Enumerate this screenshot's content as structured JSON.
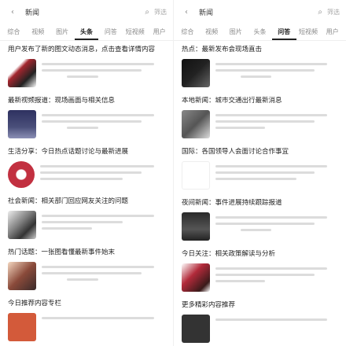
{
  "left": {
    "search_text": "新闻",
    "filter_label": "筛选",
    "tabs": [
      "综合",
      "视频",
      "图片",
      "头条",
      "问答",
      "短视频",
      "用户"
    ],
    "active_tab": 3,
    "items": [
      {
        "title": "用户发布了新的图文动态消息，点击查看详情内容",
        "thumb_color": "#a3262e"
      },
      {
        "title": "最新视频报道：现场画面与相关信息",
        "thumb_color": "#4a4f7a"
      },
      {
        "title": "生活分享：今日热点话题讨论与最新进展",
        "thumb_color": "#c23040"
      },
      {
        "title": "社会新闻：相关部门回应网友关注的问题",
        "thumb_color": "#7b7b7b"
      },
      {
        "title": "热门话题：一张图看懂最新事件始末",
        "thumb_color": "#8a4a3a"
      },
      {
        "title": "今日推荐内容专栏",
        "thumb_color": "#d35a3a"
      }
    ]
  },
  "right": {
    "search_text": "新闻",
    "filter_label": "筛选",
    "tabs": [
      "综合",
      "视频",
      "图片",
      "头条",
      "问答",
      "短视频",
      "用户"
    ],
    "active_tab": 4,
    "items": [
      {
        "title": "热点：最新发布会现场直击",
        "thumb_color": "#222222"
      },
      {
        "title": "本地新闻：城市交通出行最新消息",
        "thumb_color": "#555555"
      },
      {
        "title": "国际：各国领导人会面讨论合作事宜",
        "thumb_color": "#ffffff"
      },
      {
        "title": "夜间新闻：事件进展持续跟踪报道",
        "thumb_color": "#2a2a2a"
      },
      {
        "title": "今日关注：相关政策解读与分析",
        "thumb_color": "#b22a3a"
      },
      {
        "title": "更多精彩内容推荐",
        "thumb_color": "#333333"
      }
    ]
  }
}
